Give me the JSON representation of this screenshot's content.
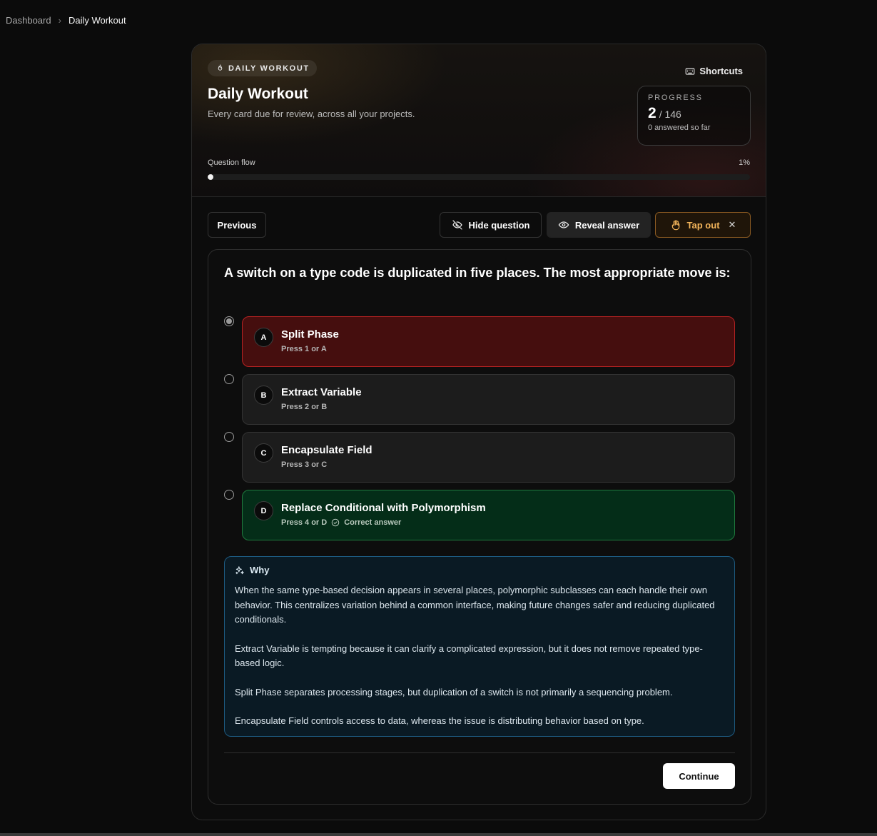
{
  "breadcrumb": {
    "root": "Dashboard",
    "separator": "›",
    "current": "Daily Workout"
  },
  "header": {
    "tag": "DAILY WORKOUT",
    "title": "Daily Workout",
    "subtitle": "Every card due for review, across all your projects.",
    "shortcuts_label": "Shortcuts"
  },
  "progress": {
    "label": "PROGRESS",
    "current": "2",
    "total": "/ 146",
    "note": "0 answered so far"
  },
  "flow": {
    "label": "Question flow",
    "percent_text": "1%",
    "fraction": 0.01
  },
  "toolbar": {
    "previous": "Previous",
    "hide": "Hide question",
    "reveal": "Reveal answer",
    "tap_out": "Tap out"
  },
  "question": {
    "text": "A switch on a type code is duplicated in five places. The most appropriate move is:",
    "options": [
      {
        "letter": "A",
        "label": "Split Phase",
        "hint": "Press 1 or A",
        "state": "wrong",
        "selected": true
      },
      {
        "letter": "B",
        "label": "Extract Variable",
        "hint": "Press 2 or B",
        "state": "neutral",
        "selected": false
      },
      {
        "letter": "C",
        "label": "Encapsulate Field",
        "hint": "Press 3 or C",
        "state": "neutral",
        "selected": false
      },
      {
        "letter": "D",
        "label": "Replace Conditional with Polymorphism",
        "hint": "Press 4 or D",
        "state": "correct",
        "selected": false,
        "correct_label": "Correct answer"
      }
    ]
  },
  "why": {
    "title": "Why",
    "paragraphs": [
      "When the same type-based decision appears in several places, polymorphic subclasses can each handle their own behavior. This centralizes variation behind a common interface, making future changes safer and reducing duplicated conditionals.",
      "Extract Variable is tempting because it can clarify a complicated expression, but it does not remove repeated type-based logic.",
      "Split Phase separates processing stages, but duplication of a switch is not primarily a sequencing problem.",
      "Encapsulate Field controls access to data, whereas the issue is distributing behavior based on type."
    ]
  },
  "footer": {
    "continue": "Continue"
  },
  "colors": {
    "wrong_bg": "#450e0e",
    "wrong_border": "#b52222",
    "correct_bg": "#042d18",
    "correct_border": "#1f7a3d",
    "tap_out_accent": "#f2b45a",
    "why_border": "#1d5a80"
  },
  "icons": {
    "tag": "flame-icon",
    "shortcuts": "keyboard-icon",
    "hide": "eye-off-icon",
    "reveal": "eye-icon",
    "tap_out": "hand-icon",
    "close": "close-icon",
    "correct": "check-circle-icon",
    "why": "sparkles-icon",
    "breadcrumb_separator": "chevron-right-icon"
  }
}
